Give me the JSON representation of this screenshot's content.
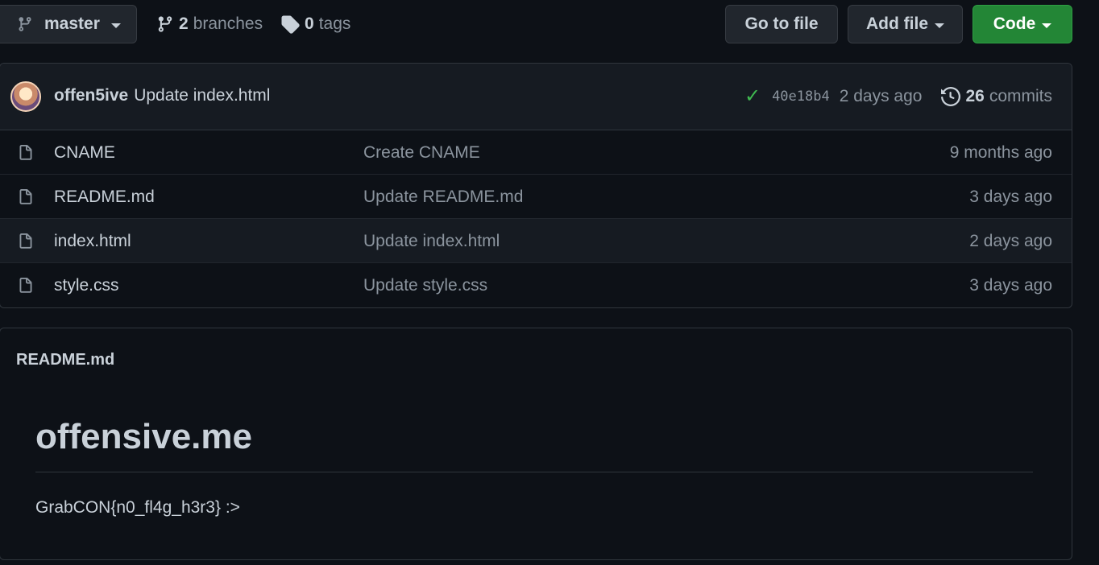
{
  "toolbar": {
    "branch": "master",
    "branches_count": "2",
    "branches_label": "branches",
    "tags_count": "0",
    "tags_label": "tags",
    "go_to_file": "Go to file",
    "add_file": "Add file",
    "code": "Code"
  },
  "commit": {
    "author": "offen5ive",
    "message": "Update index.html",
    "sha": "40e18b4",
    "age": "2 days ago",
    "commits_count": "26",
    "commits_label": "commits",
    "status": "success"
  },
  "files": [
    {
      "name": "CNAME",
      "message": "Create CNAME",
      "age": "9 months ago"
    },
    {
      "name": "README.md",
      "message": "Update README.md",
      "age": "3 days ago"
    },
    {
      "name": "index.html",
      "message": "Update index.html",
      "age": "2 days ago"
    },
    {
      "name": "style.css",
      "message": "Update style.css",
      "age": "3 days ago"
    }
  ],
  "readme": {
    "filename": "README.md",
    "heading": "offensive.me",
    "body": "GrabCON{n0_fl4g_h3r3} :>"
  },
  "colors": {
    "background": "#0d1117",
    "code_button": "#238636",
    "check": "#3fb950"
  }
}
